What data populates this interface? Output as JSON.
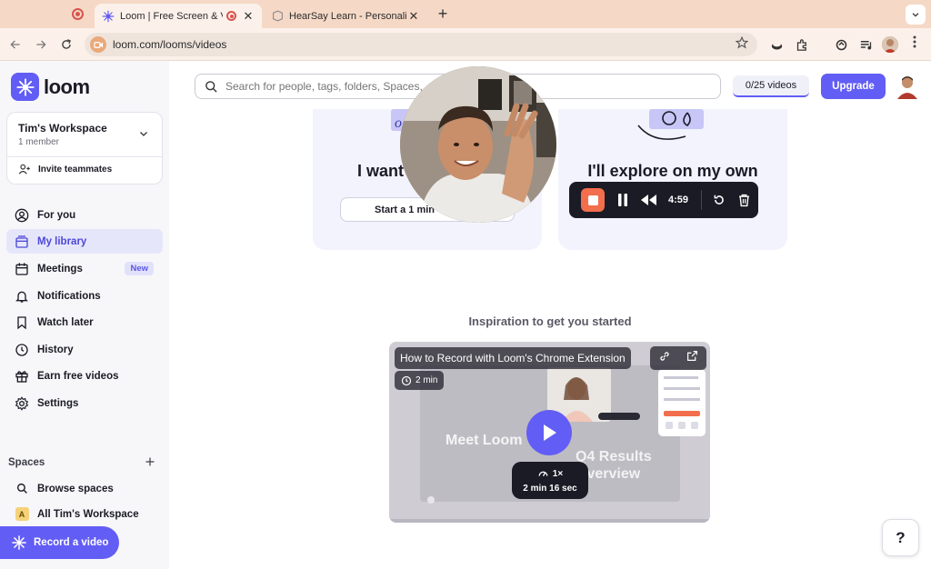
{
  "browser": {
    "tabs": [
      {
        "title": "Loom | Free Screen & Video Recording",
        "active": true
      },
      {
        "title": "HearSay Learn - Personalized",
        "active": false
      }
    ],
    "close_glyph": "✕",
    "new_tab_glyph": "+",
    "url": "loom.com/looms/videos"
  },
  "sidebar": {
    "logo_text": "loom",
    "workspace": {
      "name": "Tim's Workspace",
      "members": "1 member",
      "invite": "Invite teammates"
    },
    "nav": [
      {
        "label": "For you",
        "icon": "user-circle-icon"
      },
      {
        "label": "My library",
        "icon": "library-icon",
        "active": true
      },
      {
        "label": "Meetings",
        "icon": "calendar-icon",
        "badge": "New"
      },
      {
        "label": "Notifications",
        "icon": "bell-icon"
      },
      {
        "label": "Watch later",
        "icon": "bookmark-icon"
      },
      {
        "label": "History",
        "icon": "clock-icon"
      },
      {
        "label": "Earn free videos",
        "icon": "gift-icon"
      },
      {
        "label": "Settings",
        "icon": "gear-icon"
      }
    ],
    "spaces_label": "Spaces",
    "spaces": [
      {
        "label": "Browse spaces",
        "icon": "search-icon"
      },
      {
        "label": "All Tim's Workspace",
        "letter": "A"
      }
    ],
    "record_label": "Record a video"
  },
  "header": {
    "search_placeholder": "Search for people, tags, folders, Spaces, and Looms",
    "quota": "0/25 videos",
    "upgrade_label": "Upgrade"
  },
  "cards": [
    {
      "title": "I want",
      "button": "Start a 1 min"
    },
    {
      "title": "I'll explore on my own",
      "button": ""
    }
  ],
  "recorder": {
    "timer": "4:59"
  },
  "inspiration": {
    "heading": "Inspiration to get you started",
    "video_title": "How to Record with Loom's Chrome Extension",
    "duration": "2 min",
    "overlay_left": "Meet Loom",
    "overlay_right_1": "Q4 Results",
    "overlay_right_2": "Overview",
    "speed": "1×",
    "length": "2 min 16 sec"
  },
  "help_label": "?",
  "colors": {
    "accent": "#625df5",
    "record": "#f36e4c",
    "tabstrip": "#f5d9c6"
  }
}
